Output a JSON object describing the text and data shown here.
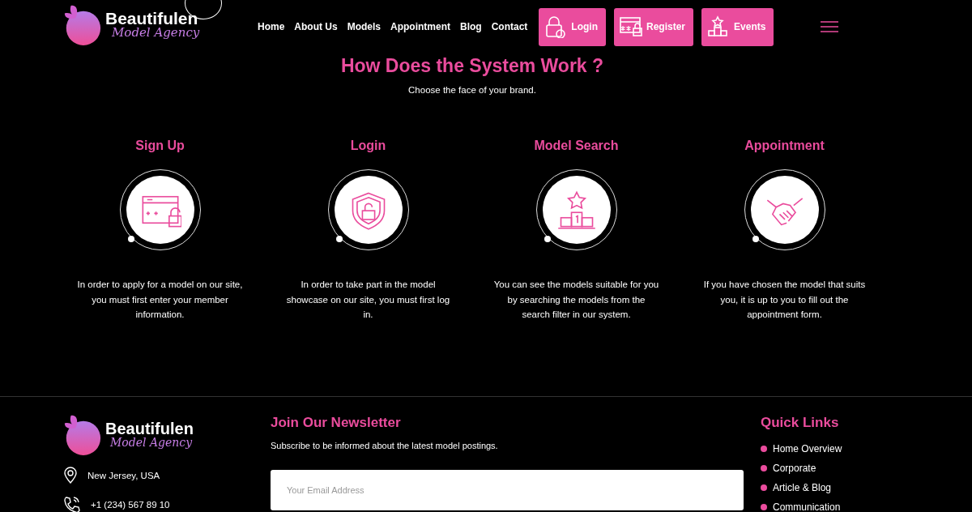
{
  "header": {
    "logo": {
      "name": "Beautifulen",
      "tagline": "Model Agency"
    },
    "nav": [
      "Home",
      "About Us",
      "Models",
      "Appointment",
      "Blog",
      "Contact"
    ],
    "buttons": [
      "Login",
      "Register",
      "Events"
    ]
  },
  "section": {
    "title": "How Does the System Work ?",
    "subtitle": "Choose the face of your brand.",
    "steps": [
      {
        "title": "Sign Up",
        "text": "In order to apply for a model on our site, you must first enter your member information."
      },
      {
        "title": "Login",
        "text": "In order to take part in the model showcase on our site, you must first log in."
      },
      {
        "title": "Model Search",
        "text": "You can see the models suitable for you by searching the models from the search filter in our system."
      },
      {
        "title": "Appointment",
        "text": "If you have chosen the model that suits you, it is up to you to fill out the appointment form."
      }
    ]
  },
  "footer": {
    "logo": {
      "name": "Beautifulen",
      "tagline": "Model Agency"
    },
    "address": "New Jersey, USA",
    "phone": "+1 (234) 567 89 10",
    "newsletter": {
      "title": "Join Our Newsletter",
      "text": "Subscribe to be informed about the latest model postings.",
      "placeholder": "Your Email Address"
    },
    "quick_links": {
      "title": "Quick Links",
      "items": [
        "Home Overview",
        "Corporate",
        "Article & Blog",
        "Communication"
      ]
    }
  }
}
